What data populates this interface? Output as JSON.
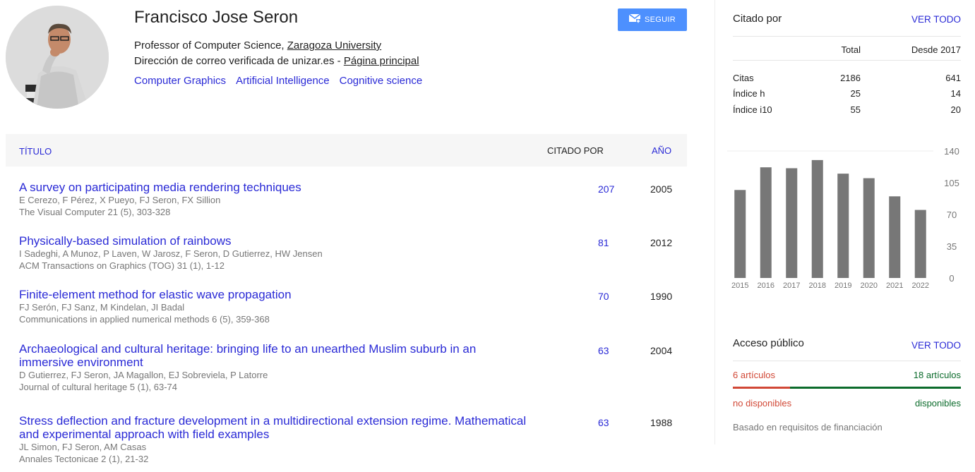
{
  "profile": {
    "name": "Francisco Jose Seron",
    "affiliation_prefix": "Professor of Computer Science, ",
    "affiliation_link": "Zaragoza University",
    "email_text": "Dirección de correo verificada de unizar.es - ",
    "homepage_link": "Página principal",
    "interests": [
      "Computer Graphics",
      "Artificial Intelligence",
      "Cognitive science"
    ],
    "follow_label": "SEGUIR"
  },
  "table": {
    "col_title": "TÍTULO",
    "col_cited": "CITADO POR",
    "col_year": "AÑO",
    "articles": [
      {
        "title": "A survey on participating media rendering techniques",
        "authors": "E Cerezo, F Pérez, X Pueyo, FJ Seron, FX Sillion",
        "venue": "The Visual Computer 21 (5), 303-328",
        "cited": "207",
        "year": "2005"
      },
      {
        "title": "Physically-based simulation of rainbows",
        "authors": "I Sadeghi, A Munoz, P Laven, W Jarosz, F Seron, D Gutierrez, HW Jensen",
        "venue": "ACM Transactions on Graphics (TOG) 31 (1), 1-12",
        "cited": "81",
        "year": "2012"
      },
      {
        "title": "Finite-element method for elastic wave propagation",
        "authors": "FJ Serón, FJ Sanz, M Kindelan, JI Badal",
        "venue": "Communications in applied numerical methods 6 (5), 359-368",
        "cited": "70",
        "year": "1990"
      },
      {
        "title": "Archaeological and cultural heritage: bringing life to an unearthed Muslim suburb in an immersive environment",
        "authors": "D Gutierrez, FJ Seron, JA Magallon, EJ Sobreviela, P Latorre",
        "venue": "Journal of cultural heritage 5 (1), 63-74",
        "cited": "63",
        "year": "2004"
      },
      {
        "title": "Stress deflection and fracture development in a multidirectional extension regime. Mathematical and experimental approach with field examples",
        "authors": "JL Simon, FJ Seron, AM Casas",
        "venue": "Annales Tectonicae 2 (1), 21-32",
        "cited": "63",
        "year": "1988"
      }
    ]
  },
  "cited_by": {
    "title": "Citado por",
    "view_all": "VER TODO",
    "col_total": "Total",
    "col_since": "Desde 2017",
    "rows": [
      {
        "label": "Citas",
        "total": "2186",
        "since": "641"
      },
      {
        "label": "Índice h",
        "total": "25",
        "since": "14"
      },
      {
        "label": "Índice i10",
        "total": "55",
        "since": "20"
      }
    ]
  },
  "chart_data": {
    "type": "bar",
    "categories": [
      "2015",
      "2016",
      "2017",
      "2018",
      "2019",
      "2020",
      "2021",
      "2022"
    ],
    "values": [
      97,
      122,
      121,
      130,
      115,
      110,
      90,
      75
    ],
    "yticks": [
      "140",
      "105",
      "70",
      "35",
      "0"
    ],
    "ylim": [
      0,
      140
    ],
    "bar_color": "#777777"
  },
  "public_access": {
    "title": "Acceso público",
    "view_all": "VER TODO",
    "unavailable_count": "6 artículos",
    "available_count": "18 artículos",
    "unavailable_label": "no disponibles",
    "available_label": "disponibles",
    "unavailable_fraction": 0.25,
    "footnote": "Basado en requisitos de financiación",
    "colors": {
      "unavailable": "#d14836",
      "available": "#0b6b2b"
    }
  },
  "colors": {
    "link": "#2a2ad6",
    "button": "#4d90fe"
  },
  "icons": {
    "follow": "mail-plus-icon"
  }
}
